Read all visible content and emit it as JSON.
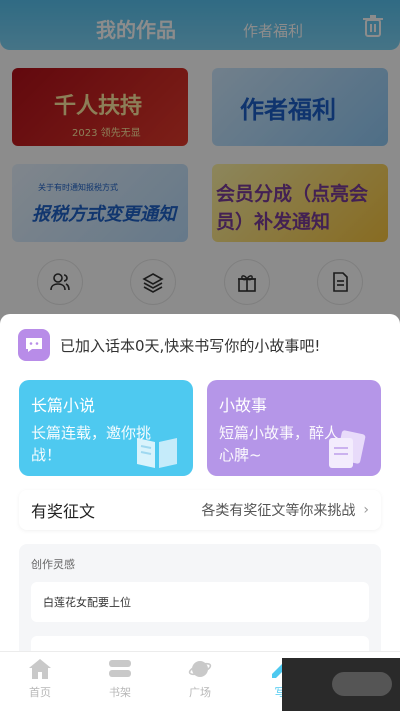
{
  "header": {
    "title": "我的作品",
    "tab_benefits": "作者福利"
  },
  "banners": {
    "b1_title": "千人扶持",
    "b1_sub": "2023 领先无显",
    "b2_title": "作者福利",
    "b3_title": "报税方式变更通知",
    "b3_sub": "关于有时通知报税方式",
    "b4_title": "会员分成（点亮会员）补发通知"
  },
  "sheet": {
    "hint": "已加入话本0天,快来书写你的小故事吧!",
    "novel": {
      "title": "长篇小说",
      "desc": "长篇连载，邀你挑战！"
    },
    "story": {
      "title": "小故事",
      "desc": "短篇小故事，醉人心脾~"
    },
    "contest": {
      "title": "有奖征文",
      "desc": "各类有奖征文等你来挑战",
      "arrow": "›"
    },
    "inspiration": {
      "title": "创作灵感",
      "item1": "白莲花女配要上位",
      "item2": ""
    }
  },
  "tabbar": [
    {
      "label": "首页"
    },
    {
      "label": "书架"
    },
    {
      "label": "广场"
    },
    {
      "label": "写"
    }
  ],
  "colors": {
    "accent": "#4ec9f0",
    "purple": "#b596e8"
  }
}
